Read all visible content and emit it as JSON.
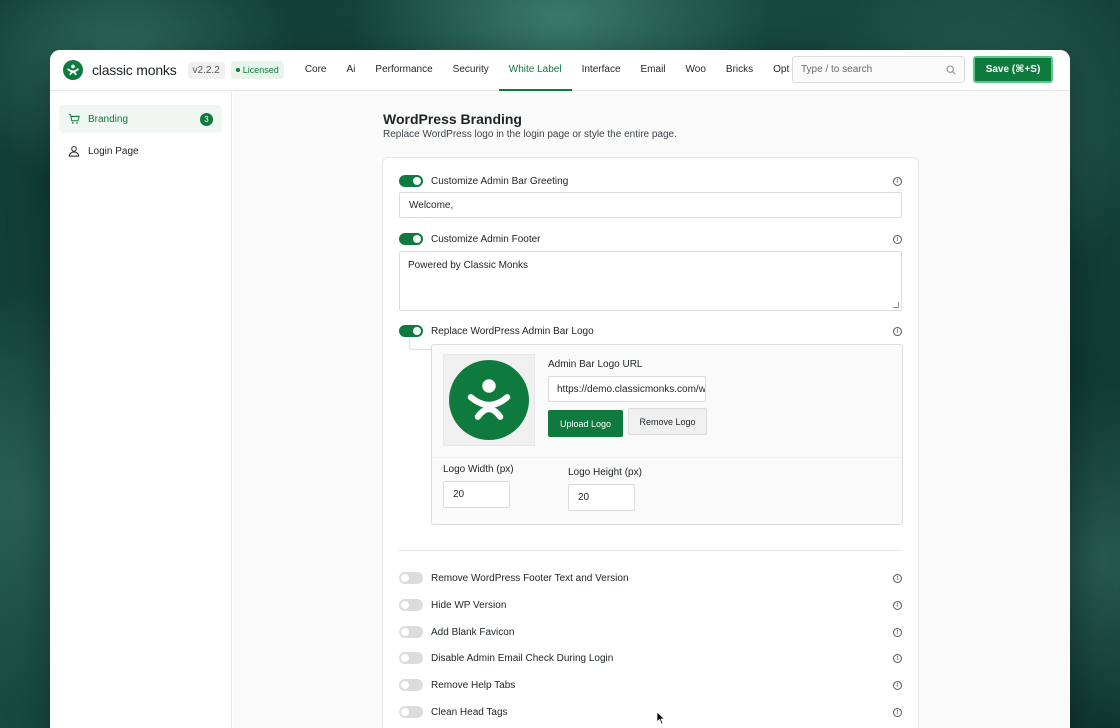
{
  "brand": {
    "name": "classic monks",
    "version": "v2.2.2",
    "license": "Licensed"
  },
  "nav": [
    {
      "label": "Core"
    },
    {
      "label": "Ai"
    },
    {
      "label": "Performance"
    },
    {
      "label": "Security"
    },
    {
      "label": "White Label"
    },
    {
      "label": "Interface"
    },
    {
      "label": "Email"
    },
    {
      "label": "Woo"
    },
    {
      "label": "Bricks"
    },
    {
      "label": "Opt"
    }
  ],
  "active_nav": "White Label",
  "search": {
    "placeholder": "Type / to search"
  },
  "save_label": "Save (⌘+S)",
  "sidebar": {
    "items": [
      {
        "label": "Branding",
        "badge": "3",
        "icon": "cart-icon"
      },
      {
        "label": "Login Page",
        "icon": "user-icon"
      }
    ]
  },
  "section": {
    "title": "WordPress Branding",
    "description": "Replace WordPress logo in the login page or style the entire page."
  },
  "settings": {
    "greeting": {
      "label": "Customize Admin Bar Greeting",
      "enabled": true,
      "value": "Welcome,"
    },
    "footer": {
      "label": "Customize Admin Footer",
      "enabled": true,
      "value": "Powered by Classic Monks"
    },
    "logo": {
      "label": "Replace WordPress Admin Bar Logo",
      "enabled": true,
      "url_label": "Admin Bar Logo URL",
      "url_value": "https://demo.classicmonks.com/wp-content/uploads/logo.png",
      "upload_label": "Upload Logo",
      "remove_label": "Remove Logo",
      "width_label": "Logo Width (px)",
      "width_value": "20",
      "height_label": "Logo Height (px)",
      "height_value": "20"
    },
    "toggles": [
      {
        "label": "Remove WordPress Footer Text and Version",
        "enabled": false
      },
      {
        "label": "Hide WP Version",
        "enabled": false
      },
      {
        "label": "Add Blank Favicon",
        "enabled": false
      },
      {
        "label": "Disable Admin Email Check During Login",
        "enabled": false
      },
      {
        "label": "Remove Help Tabs",
        "enabled": false
      },
      {
        "label": "Clean Head Tags",
        "enabled": false
      }
    ]
  },
  "colors": {
    "accent": "#0f7a3d"
  }
}
